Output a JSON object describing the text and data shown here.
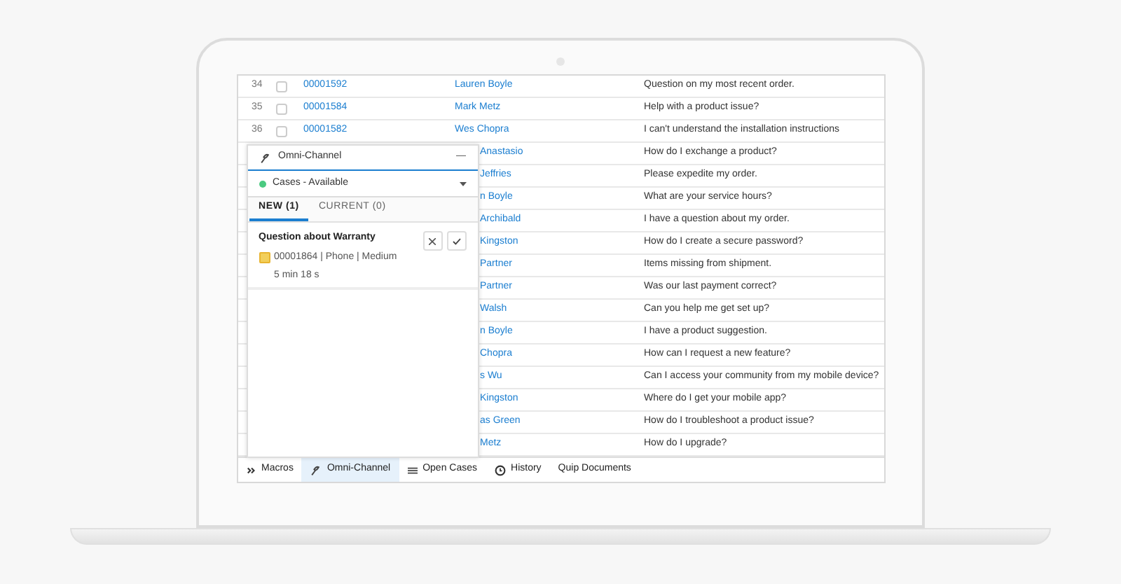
{
  "table": {
    "rows": [
      {
        "number": "34",
        "checked": false,
        "case": "00001592",
        "contact": "Lauren Boyle",
        "subject": "Question on my most recent order."
      },
      {
        "number": "35",
        "checked": false,
        "case": "00001584",
        "contact": "Mark Metz",
        "subject": "Help with a product issue?"
      },
      {
        "number": "36",
        "checked": false,
        "case": "00001582",
        "contact": "Wes Chopra",
        "subject": "I can't understand the installation instructions"
      },
      {
        "contact": "Anastasio",
        "subject": "How do I exchange a product?"
      },
      {
        "contact": "Jeffries",
        "subject": "Please expedite my order."
      },
      {
        "contact": "n Boyle",
        "subject": "What are your service hours?"
      },
      {
        "contact": "Archibald",
        "subject": "I have a question about my order."
      },
      {
        "contact": "Kingston",
        "subject": "How do I create a secure password?"
      },
      {
        "contact": "Partner",
        "subject": "Items missing from shipment."
      },
      {
        "contact": "Partner",
        "subject": "Was our last payment correct?"
      },
      {
        "contact": "Walsh",
        "subject": "Can you help me get set up?"
      },
      {
        "contact": "n Boyle",
        "subject": "I have a product suggestion."
      },
      {
        "contact": "Chopra",
        "subject": "How can I request a new feature?"
      },
      {
        "contact": "s Wu",
        "subject": "Can I access your community from my mobile device?"
      },
      {
        "contact": "Kingston",
        "subject": "Where do I get your mobile app?"
      },
      {
        "contact": "as Green",
        "subject": "How do I troubleshoot a product issue?"
      },
      {
        "contact": "Metz",
        "subject": "How do I upgrade?"
      }
    ]
  },
  "omni_channel": {
    "title": "Omni-Channel",
    "minimize": "—",
    "status": {
      "label": "Cases - Available",
      "color": "#4bca81"
    },
    "tabs": [
      {
        "label": "NEW (1)",
        "selected": true
      },
      {
        "label": "CURRENT (0)",
        "selected": false
      }
    ],
    "work_item": {
      "title": "Question about Warranty",
      "details": "00001864 | Phone | Medium",
      "time": "5 min 18 s"
    }
  },
  "utility_bar": [
    {
      "label": "Macros",
      "kind": "macros",
      "selected": false
    },
    {
      "label": "Omni-Channel",
      "kind": "omni",
      "selected": true
    },
    {
      "label": "Open Cases",
      "kind": "list",
      "selected": false
    },
    {
      "label": "History",
      "kind": "history",
      "selected": false
    },
    {
      "label": "Quip Documents",
      "kind": "plain",
      "selected": false
    }
  ]
}
